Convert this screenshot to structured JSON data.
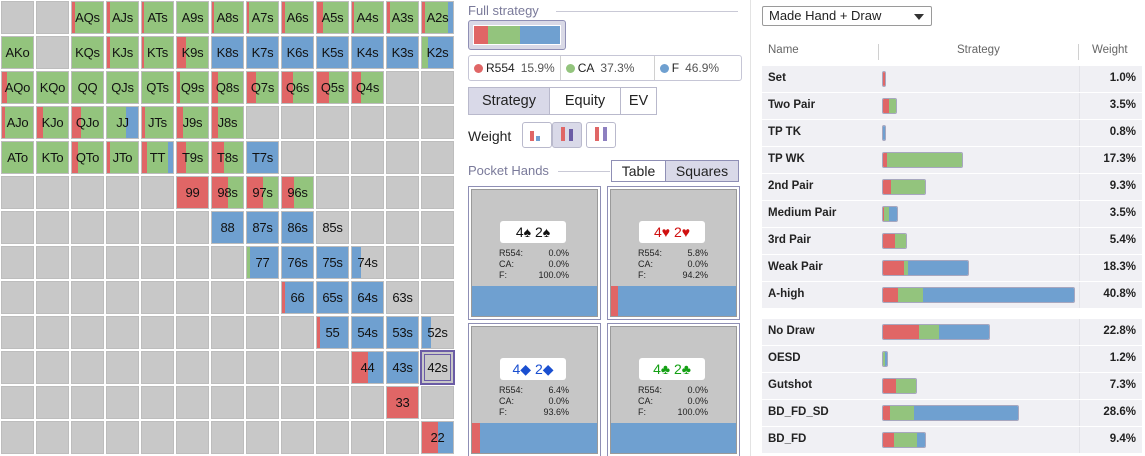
{
  "colors": {
    "raise": "#e06666",
    "call": "#93c47d",
    "fold": "#6fa0d0",
    "empty": "#c8c8c8",
    "accent": "#6b5ca5"
  },
  "grid": {
    "selected": "42s",
    "cells": [
      [
        "",
        "",
        "AQs",
        "AJs",
        "ATs",
        "A9s",
        "A8s",
        "A7s",
        "A6s",
        "A5s",
        "A4s",
        "A3s",
        "A2s"
      ],
      [
        "AKo",
        "",
        "KQs",
        "KJs",
        "KTs",
        "K9s",
        "K8s",
        "K7s",
        "K6s",
        "K5s",
        "K4s",
        "K3s",
        "K2s"
      ],
      [
        "AQo",
        "KQo",
        "QQ",
        "QJs",
        "QTs",
        "Q9s",
        "Q8s",
        "Q7s",
        "Q6s",
        "Q5s",
        "Q4s",
        "",
        ""
      ],
      [
        "AJo",
        "KJo",
        "QJo",
        "JJ",
        "JTs",
        "J9s",
        "J8s",
        "",
        "",
        "",
        "",
        "",
        ""
      ],
      [
        "ATo",
        "KTo",
        "QTo",
        "JTo",
        "TT",
        "T9s",
        "T8s",
        "T7s",
        "",
        "",
        "",
        "",
        ""
      ],
      [
        "",
        "",
        "",
        "",
        "",
        "99",
        "98s",
        "97s",
        "96s",
        "",
        "",
        "",
        ""
      ],
      [
        "",
        "",
        "",
        "",
        "",
        "",
        "88",
        "87s",
        "86s",
        "85s",
        "",
        "",
        ""
      ],
      [
        "",
        "",
        "",
        "",
        "",
        "",
        "",
        "77",
        "76s",
        "75s",
        "74s",
        "",
        ""
      ],
      [
        "",
        "",
        "",
        "",
        "",
        "",
        "",
        "",
        "66",
        "65s",
        "64s",
        "63s",
        ""
      ],
      [
        "",
        "",
        "",
        "",
        "",
        "",
        "",
        "",
        "",
        "55",
        "54s",
        "53s",
        "52s"
      ],
      [
        "",
        "",
        "",
        "",
        "",
        "",
        "",
        "",
        "",
        "",
        "44",
        "43s",
        "42s"
      ],
      [
        "",
        "",
        "",
        "",
        "",
        "",
        "",
        "",
        "",
        "",
        "",
        "33",
        ""
      ],
      [
        "",
        "",
        "",
        "",
        "",
        "",
        "",
        "",
        "",
        "",
        "",
        "",
        "22"
      ]
    ],
    "mix": {
      "AQs": [
        0.1,
        0.9,
        0
      ],
      "AJs": [
        0.1,
        0.9,
        0
      ],
      "ATs": [
        0.05,
        0.95,
        0
      ],
      "A9s": [
        0,
        1,
        0
      ],
      "A8s": [
        0.05,
        0.95,
        0
      ],
      "A7s": [
        0.05,
        0.95,
        0
      ],
      "A6s": [
        0.1,
        0.9,
        0
      ],
      "A5s": [
        0.2,
        0.8,
        0
      ],
      "A4s": [
        0.05,
        0.95,
        0
      ],
      "A3s": [
        0.1,
        0.9,
        0
      ],
      "A2s": [
        0.1,
        0.75,
        0.15
      ],
      "AKo": [
        0,
        1,
        0
      ],
      "KQs": [
        0,
        1,
        0
      ],
      "KJs": [
        0.1,
        0.9,
        0
      ],
      "KTs": [
        0.05,
        0.95,
        0
      ],
      "K9s": [
        0.3,
        0.7,
        0
      ],
      "K8s": [
        0,
        0,
        1
      ],
      "K7s": [
        0,
        0,
        1
      ],
      "K6s": [
        0,
        0,
        1
      ],
      "K5s": [
        0,
        0,
        1
      ],
      "K4s": [
        0,
        0,
        1
      ],
      "K3s": [
        0,
        0,
        1
      ],
      "K2s": [
        0,
        0.2,
        0.8
      ],
      "AQo": [
        0.15,
        0.85,
        0
      ],
      "KQo": [
        0,
        1,
        0
      ],
      "QQ": [
        0,
        1,
        0
      ],
      "QJs": [
        0,
        1,
        0
      ],
      "QTs": [
        0,
        1,
        0
      ],
      "Q9s": [
        0.1,
        0.9,
        0
      ],
      "Q8s": [
        0.2,
        0.8,
        0
      ],
      "Q7s": [
        0.3,
        0.7,
        0
      ],
      "Q6s": [
        0.35,
        0.65,
        0
      ],
      "Q5s": [
        0.4,
        0.6,
        0
      ],
      "Q4s": [
        0.3,
        0.7,
        0
      ],
      "AJo": [
        0.1,
        0.9,
        0
      ],
      "KJo": [
        0.2,
        0.8,
        0
      ],
      "QJo": [
        0.3,
        0.7,
        0
      ],
      "JJ": [
        0,
        0.6,
        0.4
      ],
      "JTs": [
        0.1,
        0.9,
        0
      ],
      "J9s": [
        0.2,
        0.8,
        0
      ],
      "J8s": [
        0.2,
        0.8,
        0
      ],
      "ATo": [
        0,
        1,
        0
      ],
      "KTo": [
        0,
        1,
        0
      ],
      "QTo": [
        0.2,
        0.8,
        0
      ],
      "JTo": [
        0.1,
        0.9,
        0
      ],
      "TT": [
        0.15,
        0.7,
        0.15
      ],
      "T9s": [
        0.3,
        0.7,
        0
      ],
      "T8s": [
        0.4,
        0.6,
        0
      ],
      "T7s": [
        0,
        0,
        1
      ],
      "99": [
        1,
        0,
        0
      ],
      "98s": [
        0.5,
        0.5,
        0
      ],
      "97s": [
        0.5,
        0.5,
        0
      ],
      "96s": [
        0.4,
        0.6,
        0
      ],
      "88": [
        0,
        0,
        1
      ],
      "87s": [
        0,
        0,
        1
      ],
      "86s": [
        0,
        0,
        1
      ],
      "85s": [
        0,
        0,
        0
      ],
      "77": [
        0,
        0.1,
        0.9
      ],
      "76s": [
        0,
        0,
        1
      ],
      "75s": [
        0,
        0,
        1
      ],
      "74s": [
        0,
        0,
        0.3
      ],
      "66": [
        0.1,
        0,
        0.9
      ],
      "65s": [
        0,
        0,
        1
      ],
      "64s": [
        0,
        0,
        1
      ],
      "63s": [
        0,
        0,
        0
      ],
      "55": [
        0.1,
        0,
        0.9
      ],
      "54s": [
        0,
        0,
        1
      ],
      "53s": [
        0,
        0,
        1
      ],
      "52s": [
        0,
        0,
        0.3
      ],
      "44": [
        0.5,
        0,
        0.5
      ],
      "43s": [
        0,
        0,
        1
      ],
      "42s": [
        0,
        0,
        0
      ],
      "33": [
        1,
        0,
        0
      ],
      "22": [
        0.5,
        0,
        0.5
      ]
    }
  },
  "full_strategy": {
    "title": "Full strategy",
    "mix": [
      0.159,
      0.373,
      0.469
    ],
    "legend": [
      {
        "name": "R554",
        "pct": "15.9%",
        "color": "#e06666"
      },
      {
        "name": "CA",
        "pct": "37.3%",
        "color": "#93c47d"
      },
      {
        "name": "F",
        "pct": "46.9%",
        "color": "#6fa0d0"
      }
    ]
  },
  "modes": {
    "strategy": "Strategy",
    "equity": "Equity",
    "ev": "EV"
  },
  "weight_label": "Weight",
  "pocket_hands": {
    "title": "Pocket Hands",
    "table_tab": "Table",
    "squares_tab": "Squares",
    "combos": [
      {
        "cards": "4♠ 2♠",
        "color": "#111111",
        "r": "0.0%",
        "ca": "0.0%",
        "f": "100.0%",
        "mix": [
          0,
          0,
          1
        ]
      },
      {
        "cards": "4♥ 2♥",
        "color": "#d01010",
        "r": "5.8%",
        "ca": "0.0%",
        "f": "94.2%",
        "mix": [
          0.058,
          0,
          0.942
        ]
      },
      {
        "cards": "4◆ 2◆",
        "color": "#1a4fd0",
        "r": "6.4%",
        "ca": "0.0%",
        "f": "93.6%",
        "mix": [
          0.064,
          0,
          0.936
        ]
      },
      {
        "cards": "4♣ 2♣",
        "color": "#14a014",
        "r": "0.0%",
        "ca": "0.0%",
        "f": "100.0%",
        "mix": [
          0,
          0,
          1
        ]
      }
    ],
    "labels": {
      "r": "R554:",
      "ca": "CA:",
      "f": "F:"
    }
  },
  "hand_table": {
    "dropdown": "Made Hand + Draw",
    "headers": {
      "name": "Name",
      "strategy": "Strategy",
      "weight": "Weight"
    },
    "rows": [
      {
        "name": "Set",
        "weight": "1.0%",
        "width": 0.02,
        "mix": [
          1,
          0,
          0
        ]
      },
      {
        "name": "Two Pair",
        "weight": "3.5%",
        "width": 0.08,
        "mix": [
          0.45,
          0.55,
          0
        ]
      },
      {
        "name": "TP TK",
        "weight": "0.8%",
        "width": 0.015,
        "mix": [
          0,
          0,
          1
        ]
      },
      {
        "name": "TP WK",
        "weight": "17.3%",
        "width": 0.42,
        "mix": [
          0.05,
          0.95,
          0
        ]
      },
      {
        "name": "2nd Pair",
        "weight": "9.3%",
        "width": 0.23,
        "mix": [
          0.2,
          0.8,
          0
        ]
      },
      {
        "name": "Medium Pair",
        "weight": "3.5%",
        "width": 0.085,
        "mix": [
          0.05,
          0.35,
          0.6
        ]
      },
      {
        "name": "3rd Pair",
        "weight": "5.4%",
        "width": 0.13,
        "mix": [
          0.5,
          0.5,
          0
        ]
      },
      {
        "name": "Weak Pair",
        "weight": "18.3%",
        "width": 0.45,
        "mix": [
          0.25,
          0.05,
          0.7
        ]
      },
      {
        "name": "A-high",
        "weight": "40.8%",
        "width": 1.0,
        "mix": [
          0.08,
          0.13,
          0.79
        ]
      },
      {
        "name": "No Draw",
        "weight": "22.8%",
        "width": 0.56,
        "mix": [
          0.34,
          0.19,
          0.47
        ]
      },
      {
        "name": "OESD",
        "weight": "1.2%",
        "width": 0.03,
        "mix": [
          0,
          0.5,
          0.5
        ]
      },
      {
        "name": "Gutshot",
        "weight": "7.3%",
        "width": 0.18,
        "mix": [
          0.4,
          0.6,
          0
        ]
      },
      {
        "name": "BD_FD_SD",
        "weight": "28.6%",
        "width": 0.71,
        "mix": [
          0.05,
          0.18,
          0.77
        ]
      },
      {
        "name": "BD_FD",
        "weight": "9.4%",
        "width": 0.23,
        "mix": [
          0.25,
          0.55,
          0.2
        ]
      }
    ]
  }
}
